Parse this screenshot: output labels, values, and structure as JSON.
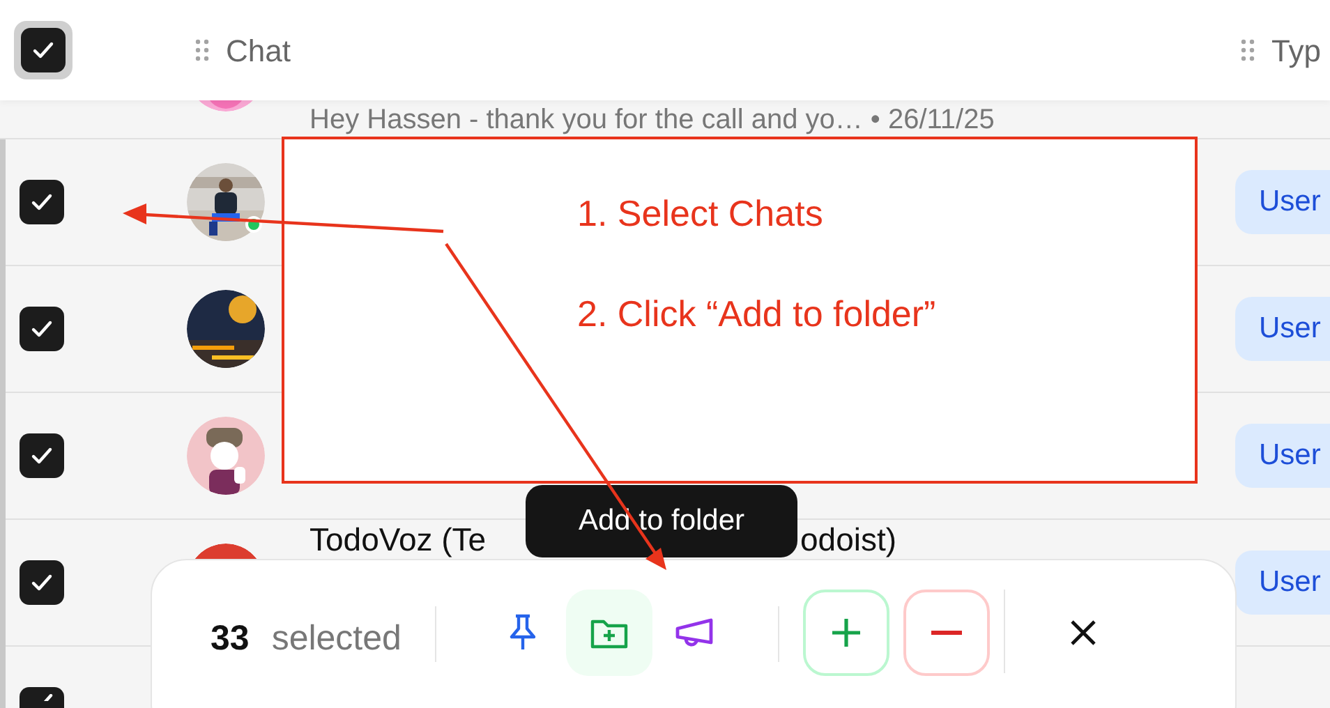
{
  "header": {
    "select_all_checked": true,
    "columns": [
      "Chat",
      "Typ"
    ]
  },
  "rows": [
    {
      "kind": "partial",
      "message": "Hey Hassen - thank you for the call and yo… • 26/11/25"
    },
    {
      "kind": "full",
      "checked": true,
      "online": true,
      "type": "User"
    },
    {
      "kind": "full",
      "checked": true,
      "online": false,
      "type": "User"
    },
    {
      "kind": "full",
      "checked": true,
      "online": false,
      "type": "User"
    },
    {
      "kind": "full",
      "checked": true,
      "online": false,
      "name_start": "TodoVoz (Te",
      "name_end": "odoist)",
      "type": "User"
    },
    {
      "kind": "full",
      "checked": true
    }
  ],
  "annotation": {
    "steps": [
      "1. Select Chats",
      "2. Click “Add to folder”"
    ]
  },
  "tooltip": "Add to folder",
  "selection_bar": {
    "count": "33",
    "label": "selected",
    "actions": [
      {
        "kind": "pin",
        "selected": false
      },
      {
        "kind": "folder-add",
        "selected": true
      },
      {
        "kind": "megaphone",
        "selected": false
      },
      {
        "kind": "add",
        "selected": false
      },
      {
        "kind": "remove",
        "selected": false
      },
      {
        "kind": "close",
        "selected": false
      }
    ]
  }
}
